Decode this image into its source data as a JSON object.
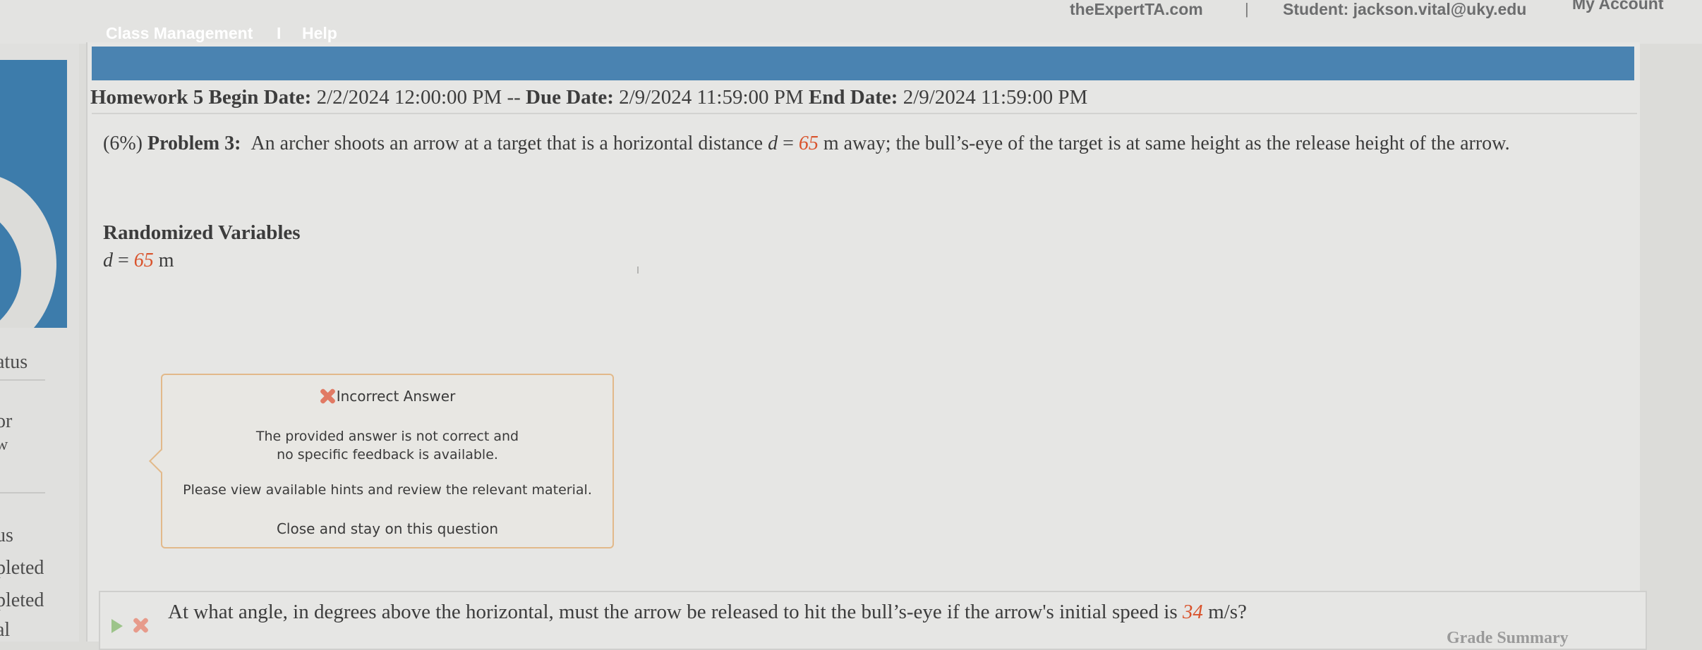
{
  "top_bar": {
    "site": "theExpertTA.com",
    "separator": "|",
    "student": "Student: jackson.vital@uky.edu",
    "account": "My Account"
  },
  "sidebar": {
    "fragments": [
      "atus",
      "or",
      "w",
      "us",
      "pleted",
      "pleted",
      "al"
    ]
  },
  "nav": {
    "class_management": "Class Management",
    "separator": "I",
    "help": "Help"
  },
  "homework": {
    "title": "Homework 5",
    "begin_label": "Begin Date:",
    "begin_value": "2/2/2024 12:00:00 PM",
    "dash": "--",
    "due_label": "Due Date:",
    "due_value": "2/9/2024 11:59:00 PM",
    "end_label": "End Date:",
    "end_value": "2/9/2024 11:59:00 PM"
  },
  "problem": {
    "weight": "(6%)",
    "label": "Problem 3:",
    "text_before": "An archer shoots an arrow at a target that is a horizontal distance",
    "var_name": "d",
    "equals": " = ",
    "var_value": "65",
    "text_after": " m away; the bull’s-eye of the target is at same height as the release height of the arrow."
  },
  "randomized": {
    "title": "Randomized Variables",
    "var_name": "d",
    "equals": " = ",
    "value": "65",
    "unit": " m"
  },
  "feedback": {
    "title": "Incorrect Answer",
    "message_line1": "The provided answer is not correct and",
    "message_line2": "no specific feedback is available.",
    "hint": "Please view available hints and review the relevant material.",
    "close": "Close and stay on this question"
  },
  "question": {
    "text_before": "At what angle, in degrees above the horizontal, must the arrow be released to hit the bull’s-eye if the arrow's initial speed is",
    "speed_value": "34",
    "text_after": " m/s?"
  },
  "grade_summary": "Grade Summary",
  "colors": {
    "nav_blue": "#4a83b1",
    "variable_red": "#d9532c",
    "popup_border": "#e2b98a",
    "incorrect_icon": "#e17a64"
  }
}
